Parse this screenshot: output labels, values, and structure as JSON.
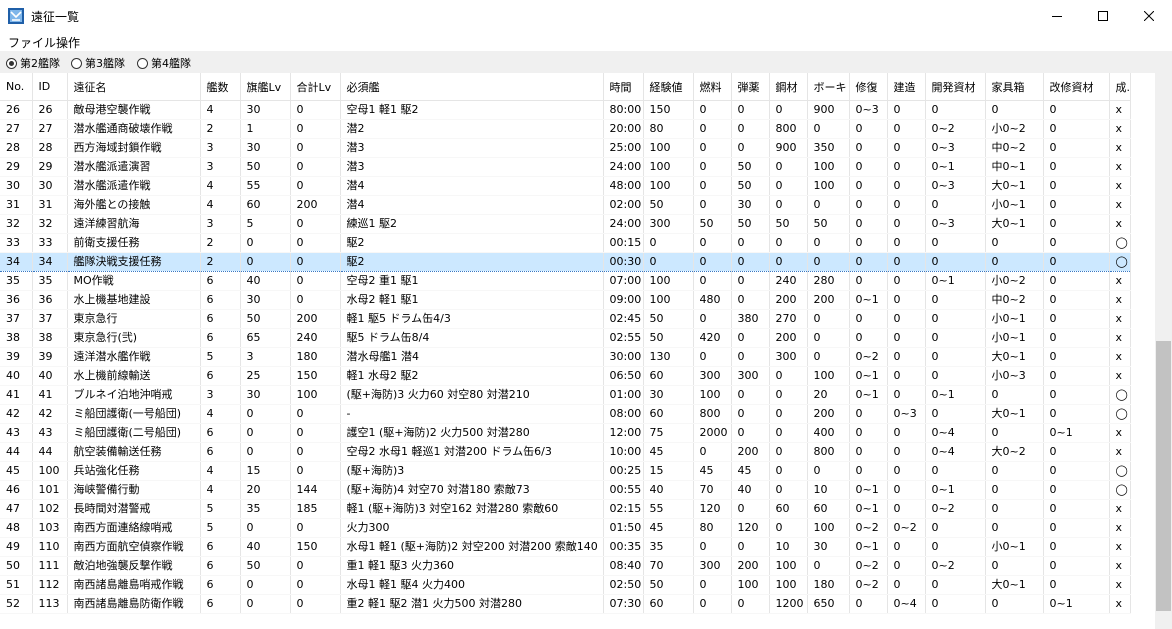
{
  "window": {
    "title": "遠征一覧"
  },
  "menu": [
    "ファイル",
    "操作"
  ],
  "radios": [
    {
      "label": "第2艦隊",
      "checked": true
    },
    {
      "label": "第3艦隊",
      "checked": false
    },
    {
      "label": "第4艦隊",
      "checked": false
    }
  ],
  "columns": [
    "No.",
    "ID",
    "遠征名",
    "艦数",
    "旗艦Lv",
    "合計Lv",
    "必須艦",
    "時間",
    "経験値",
    "燃料",
    "弾薬",
    "鋼材",
    "ボーキ",
    "修復",
    "建造",
    "開発資材",
    "家具箱",
    "改修資材",
    "成."
  ],
  "selected_no": "34",
  "rows": [
    [
      "26",
      "26",
      "敵母港空襲作戦",
      "4",
      "30",
      "0",
      "空母1 軽1 駆2",
      "80:00",
      "150",
      "0",
      "0",
      "0",
      "900",
      "0~3",
      "0",
      "0",
      "0",
      "0",
      "x"
    ],
    [
      "27",
      "27",
      "潜水艦通商破壊作戦",
      "2",
      "1",
      "0",
      "潜2",
      "20:00",
      "80",
      "0",
      "0",
      "800",
      "0",
      "0",
      "0",
      "0~2",
      "小0~2",
      "0",
      "x"
    ],
    [
      "28",
      "28",
      "西方海域封鎖作戦",
      "3",
      "30",
      "0",
      "潜3",
      "25:00",
      "100",
      "0",
      "0",
      "900",
      "350",
      "0",
      "0",
      "0~3",
      "中0~2",
      "0",
      "x"
    ],
    [
      "29",
      "29",
      "潜水艦派遣演習",
      "3",
      "50",
      "0",
      "潜3",
      "24:00",
      "100",
      "0",
      "50",
      "0",
      "100",
      "0",
      "0",
      "0~1",
      "中0~1",
      "0",
      "x"
    ],
    [
      "30",
      "30",
      "潜水艦派遣作戦",
      "4",
      "55",
      "0",
      "潜4",
      "48:00",
      "100",
      "0",
      "50",
      "0",
      "100",
      "0",
      "0",
      "0~3",
      "大0~1",
      "0",
      "x"
    ],
    [
      "31",
      "31",
      "海外艦との接触",
      "4",
      "60",
      "200",
      "潜4",
      "02:00",
      "50",
      "0",
      "30",
      "0",
      "0",
      "0",
      "0",
      "0",
      "小0~1",
      "0",
      "x"
    ],
    [
      "32",
      "32",
      "遠洋練習航海",
      "3",
      "5",
      "0",
      "練巡1 駆2",
      "24:00",
      "300",
      "50",
      "50",
      "50",
      "50",
      "0",
      "0",
      "0~3",
      "大0~1",
      "0",
      "x"
    ],
    [
      "33",
      "33",
      "前衛支援任務",
      "2",
      "0",
      "0",
      "駆2",
      "00:15",
      "0",
      "0",
      "0",
      "0",
      "0",
      "0",
      "0",
      "0",
      "0",
      "0",
      "◯"
    ],
    [
      "34",
      "34",
      "艦隊決戦支援任務",
      "2",
      "0",
      "0",
      "駆2",
      "00:30",
      "0",
      "0",
      "0",
      "0",
      "0",
      "0",
      "0",
      "0",
      "0",
      "0",
      "◯"
    ],
    [
      "35",
      "35",
      "MO作戦",
      "6",
      "40",
      "0",
      "空母2 重1 駆1",
      "07:00",
      "100",
      "0",
      "0",
      "240",
      "280",
      "0",
      "0",
      "0~1",
      "小0~2",
      "0",
      "x"
    ],
    [
      "36",
      "36",
      "水上機基地建設",
      "6",
      "30",
      "0",
      "水母2 軽1 駆1",
      "09:00",
      "100",
      "480",
      "0",
      "200",
      "200",
      "0~1",
      "0",
      "0",
      "中0~2",
      "0",
      "x"
    ],
    [
      "37",
      "37",
      "東京急行",
      "6",
      "50",
      "200",
      "軽1 駆5 ドラム缶4/3",
      "02:45",
      "50",
      "0",
      "380",
      "270",
      "0",
      "0",
      "0",
      "0",
      "小0~1",
      "0",
      "x"
    ],
    [
      "38",
      "38",
      "東京急行(弐)",
      "6",
      "65",
      "240",
      "駆5 ドラム缶8/4",
      "02:55",
      "50",
      "420",
      "0",
      "200",
      "0",
      "0",
      "0",
      "0",
      "小0~1",
      "0",
      "x"
    ],
    [
      "39",
      "39",
      "遠洋潜水艦作戦",
      "5",
      "3",
      "180",
      "潜水母艦1 潜4",
      "30:00",
      "130",
      "0",
      "0",
      "300",
      "0",
      "0~2",
      "0",
      "0",
      "大0~1",
      "0",
      "x"
    ],
    [
      "40",
      "40",
      "水上機前線輸送",
      "6",
      "25",
      "150",
      "軽1 水母2 駆2",
      "06:50",
      "60",
      "300",
      "300",
      "0",
      "100",
      "0~1",
      "0",
      "0",
      "小0~3",
      "0",
      "x"
    ],
    [
      "41",
      "41",
      "ブルネイ泊地沖哨戒",
      "3",
      "30",
      "100",
      "(駆+海防)3 火力60 対空80 対潜210",
      "01:00",
      "30",
      "100",
      "0",
      "0",
      "20",
      "0~1",
      "0",
      "0~1",
      "0",
      "0",
      "◯"
    ],
    [
      "42",
      "42",
      "ミ船団護衛(一号船団)",
      "4",
      "0",
      "0",
      "-",
      "08:00",
      "60",
      "800",
      "0",
      "0",
      "200",
      "0",
      "0~3",
      "0",
      "大0~1",
      "0",
      "◯"
    ],
    [
      "43",
      "43",
      "ミ船団護衛(二号船団)",
      "6",
      "0",
      "0",
      "護空1 (駆+海防)2 火力500 対潜280",
      "12:00",
      "75",
      "2000",
      "0",
      "0",
      "400",
      "0",
      "0",
      "0~4",
      "0",
      "0~1",
      "x"
    ],
    [
      "44",
      "44",
      "航空装備輸送任務",
      "6",
      "0",
      "0",
      "空母2 水母1 軽巡1 対潜200 ドラム缶6/3",
      "10:00",
      "45",
      "0",
      "200",
      "0",
      "800",
      "0",
      "0",
      "0~4",
      "大0~2",
      "0",
      "x"
    ],
    [
      "45",
      "100",
      "兵站強化任務",
      "4",
      "15",
      "0",
      "(駆+海防)3",
      "00:25",
      "15",
      "45",
      "45",
      "0",
      "0",
      "0",
      "0",
      "0",
      "0",
      "0",
      "◯"
    ],
    [
      "46",
      "101",
      "海峡警備行動",
      "4",
      "20",
      "144",
      "(駆+海防)4 対空70 対潜180 索敵73",
      "00:55",
      "40",
      "70",
      "40",
      "0",
      "10",
      "0~1",
      "0",
      "0~1",
      "0",
      "0",
      "◯"
    ],
    [
      "47",
      "102",
      "長時間対潜警戒",
      "5",
      "35",
      "185",
      "軽1 (駆+海防)3 対空162 対潜280 索敵60",
      "02:15",
      "55",
      "120",
      "0",
      "60",
      "60",
      "0~1",
      "0",
      "0~2",
      "0",
      "0",
      "x"
    ],
    [
      "48",
      "103",
      "南西方面連絡線哨戒",
      "5",
      "0",
      "0",
      "火力300",
      "01:50",
      "45",
      "80",
      "120",
      "0",
      "100",
      "0~2",
      "0~2",
      "0",
      "0",
      "0",
      "x"
    ],
    [
      "49",
      "110",
      "南西方面航空偵察作戦",
      "6",
      "40",
      "150",
      "水母1 軽1 (駆+海防)2 対空200 対潜200 索敵140",
      "00:35",
      "35",
      "0",
      "0",
      "10",
      "30",
      "0~1",
      "0",
      "0",
      "小0~1",
      "0",
      "x"
    ],
    [
      "50",
      "111",
      "敵泊地強襲反撃作戦",
      "6",
      "50",
      "0",
      "重1 軽1 駆3 火力360",
      "08:40",
      "70",
      "300",
      "200",
      "100",
      "0",
      "0~2",
      "0",
      "0~2",
      "0",
      "0",
      "x"
    ],
    [
      "51",
      "112",
      "南西諸島離島哨戒作戦",
      "6",
      "0",
      "0",
      "水母1 軽1 駆4 火力400",
      "02:50",
      "50",
      "0",
      "100",
      "100",
      "180",
      "0~2",
      "0",
      "0",
      "大0~1",
      "0",
      "x"
    ],
    [
      "52",
      "113",
      "南西諸島離島防衛作戦",
      "6",
      "0",
      "0",
      "重2 軽1 駆2 潜1 火力500 対潜280",
      "07:30",
      "60",
      "0",
      "0",
      "1200",
      "650",
      "0",
      "0~4",
      "0",
      "0",
      "0~1",
      "x"
    ]
  ]
}
